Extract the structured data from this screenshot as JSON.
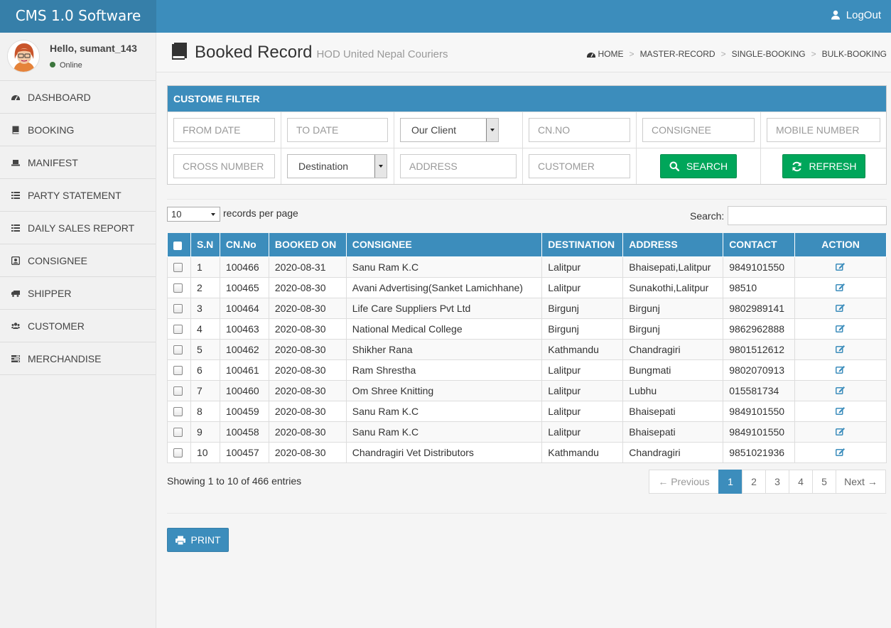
{
  "app": {
    "brand": "CMS 1.0 Software",
    "logout_label": "LogOut"
  },
  "user": {
    "greeting": "Hello, sumant_143",
    "status": "Online"
  },
  "sidebar": {
    "items": [
      {
        "label": "DASHBOARD",
        "icon": "dashboard-icon"
      },
      {
        "label": "BOOKING",
        "icon": "book-icon"
      },
      {
        "label": "MANIFEST",
        "icon": "laptop-icon"
      },
      {
        "label": "PARTY STATEMENT",
        "icon": "list-icon"
      },
      {
        "label": "DAILY SALES REPORT",
        "icon": "list-icon"
      },
      {
        "label": "CONSIGNEE",
        "icon": "contact-icon"
      },
      {
        "label": "SHIPPER",
        "icon": "truck-icon"
      },
      {
        "label": "CUSTOMER",
        "icon": "users-icon"
      },
      {
        "label": "MERCHANDISE",
        "icon": "tasks-icon"
      }
    ]
  },
  "header": {
    "title": "Booked Record",
    "subtitle": "HOD United Nepal Couriers",
    "breadcrumb": [
      "HOME",
      "MASTER-RECORD",
      "SINGLE-BOOKING",
      "BULK-BOOKING"
    ]
  },
  "filter": {
    "title": "CUSTOME FILTER",
    "from_date": "FROM DATE",
    "to_date": "TO DATE",
    "client_select": "Our Client",
    "cn_no": "CN.NO",
    "consignee": "CONSIGNEE",
    "mobile": "MOBILE NUMBER",
    "cross_number": "CROSS NUMBER",
    "destination_select": "Destination",
    "address": "ADDRESS",
    "customer": "CUSTOMER",
    "search_label": "SEARCH",
    "refresh_label": "REFRESH"
  },
  "records": {
    "per_page": "10",
    "per_page_label": "records per page",
    "search_label": "Search:"
  },
  "table": {
    "columns": [
      "S.N",
      "CN.No",
      "BOOKED ON",
      "CONSIGNEE",
      "DESTINATION",
      "ADDRESS",
      "CONTACT",
      "ACTION"
    ],
    "rows": [
      {
        "sn": "1",
        "cn": "100466",
        "booked": "2020-08-31",
        "consignee": "Sanu Ram K.C",
        "destination": "Lalitpur",
        "address": "Bhaisepati,Lalitpur",
        "contact": "9849101550"
      },
      {
        "sn": "2",
        "cn": "100465",
        "booked": "2020-08-30",
        "consignee": "Avani Advertising(Sanket Lamichhane)",
        "destination": "Lalitpur",
        "address": "Sunakothi,Lalitpur",
        "contact": "98510"
      },
      {
        "sn": "3",
        "cn": "100464",
        "booked": "2020-08-30",
        "consignee": "Life Care Suppliers Pvt Ltd",
        "destination": "Birgunj",
        "address": "Birgunj",
        "contact": "9802989141"
      },
      {
        "sn": "4",
        "cn": "100463",
        "booked": "2020-08-30",
        "consignee": "National Medical College",
        "destination": "Birgunj",
        "address": "Birgunj",
        "contact": "9862962888"
      },
      {
        "sn": "5",
        "cn": "100462",
        "booked": "2020-08-30",
        "consignee": "Shikher Rana",
        "destination": "Kathmandu",
        "address": "Chandragiri",
        "contact": "9801512612"
      },
      {
        "sn": "6",
        "cn": "100461",
        "booked": "2020-08-30",
        "consignee": "Ram Shrestha",
        "destination": "Lalitpur",
        "address": "Bungmati",
        "contact": "9802070913"
      },
      {
        "sn": "7",
        "cn": "100460",
        "booked": "2020-08-30",
        "consignee": "Om Shree Knitting",
        "destination": "Lalitpur",
        "address": "Lubhu",
        "contact": "015581734"
      },
      {
        "sn": "8",
        "cn": "100459",
        "booked": "2020-08-30",
        "consignee": "Sanu Ram K.C",
        "destination": "Lalitpur",
        "address": "Bhaisepati",
        "contact": "9849101550"
      },
      {
        "sn": "9",
        "cn": "100458",
        "booked": "2020-08-30",
        "consignee": "Sanu Ram K.C",
        "destination": "Lalitpur",
        "address": "Bhaisepati",
        "contact": "9849101550"
      },
      {
        "sn": "10",
        "cn": "100457",
        "booked": "2020-08-30",
        "consignee": "Chandragiri Vet Distributors",
        "destination": "Kathmandu",
        "address": "Chandragiri",
        "contact": "9851021936"
      }
    ]
  },
  "footer": {
    "showing": "Showing 1 to 10 of 466 entries",
    "pagination": {
      "previous": "← Previous",
      "pages": [
        "1",
        "2",
        "3",
        "4",
        "5"
      ],
      "active_page": "1",
      "next": "Next →"
    },
    "print_label": "PRINT"
  },
  "colors": {
    "primary": "#3c8dbc",
    "brand_dark": "#367fa9",
    "success": "#00a65a",
    "online": "#3c763d"
  }
}
